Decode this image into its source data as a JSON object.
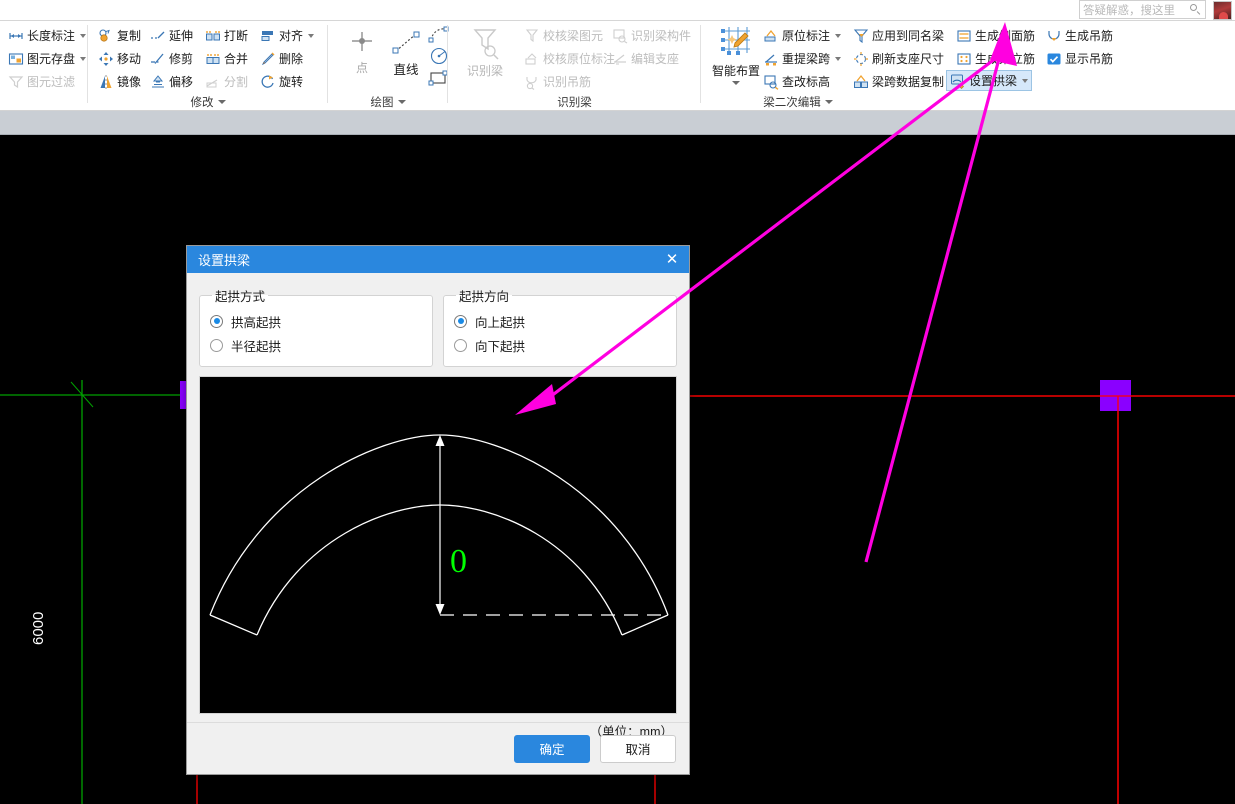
{
  "search": {
    "placeholder": "答疑解惑，搜这里",
    "icon": "search-icon",
    "avatar_name": "user-avatar"
  },
  "ribbon": {
    "groups": [
      {
        "name": "annotation",
        "label": "",
        "items": [
          {
            "label": "长度标注",
            "icon": "length-dimension-icon",
            "caret": true,
            "disabled": false
          },
          {
            "label": "图元存盘",
            "icon": "save-element-icon",
            "caret": true,
            "disabled": false
          },
          {
            "label": "图元过滤",
            "icon": "filter-element-icon",
            "caret": false,
            "disabled": true
          }
        ]
      },
      {
        "name": "modify",
        "label": "修改",
        "caret": true,
        "items": [
          {
            "label": "复制",
            "icon": "copy-icon",
            "disabled": false
          },
          {
            "label": "延伸",
            "icon": "extend-icon",
            "disabled": false
          },
          {
            "label": "打断",
            "icon": "break-icon",
            "disabled": false
          },
          {
            "label": "对齐",
            "icon": "align-icon",
            "caret": true,
            "disabled": false
          },
          {
            "label": "移动",
            "icon": "move-icon",
            "disabled": false
          },
          {
            "label": "修剪",
            "icon": "trim-icon",
            "disabled": false
          },
          {
            "label": "合并",
            "icon": "merge-icon",
            "disabled": false
          },
          {
            "label": "删除",
            "icon": "delete-icon",
            "disabled": false
          },
          {
            "label": "镜像",
            "icon": "mirror-icon",
            "disabled": false
          },
          {
            "label": "偏移",
            "icon": "offset-icon",
            "disabled": false
          },
          {
            "label": "分割",
            "icon": "split-icon",
            "disabled": true
          },
          {
            "label": "旋转",
            "icon": "rotate-icon",
            "disabled": false
          }
        ]
      },
      {
        "name": "draw",
        "label": "绘图",
        "caret": true,
        "items": [
          {
            "label": "点",
            "icon": "point-icon",
            "disabled": true
          },
          {
            "label": "直线",
            "icon": "line-icon",
            "disabled": false
          },
          {
            "label": "",
            "icon": "arc-icon",
            "disabled": false
          },
          {
            "label": "",
            "icon": "circle-icon",
            "disabled": false
          },
          {
            "label": "",
            "icon": "rectangle-icon",
            "disabled": false
          }
        ]
      },
      {
        "name": "identify-beam",
        "label": "识别梁",
        "caret": false,
        "big": {
          "label": "识别梁",
          "icon": "identify-beam-icon",
          "disabled": true
        },
        "items": [
          {
            "label": "校核梁图元",
            "icon": "check-beam-element-icon",
            "disabled": true
          },
          {
            "label": "识别梁构件",
            "icon": "identify-beam-member-icon",
            "disabled": true
          },
          {
            "label": "校核原位标注",
            "icon": "check-inplace-note-icon",
            "disabled": true
          },
          {
            "label": "编辑支座",
            "icon": "edit-support-icon",
            "disabled": true
          },
          {
            "label": "识别吊筋",
            "icon": "identify-hanger-icon",
            "disabled": true
          }
        ]
      },
      {
        "name": "beam-secondary-edit",
        "label": "梁二次编辑",
        "caret": true,
        "big": {
          "label": "智能布置",
          "icon": "smart-layout-icon",
          "caret": true,
          "disabled": false
        },
        "items": [
          {
            "label": "原位标注",
            "icon": "inplace-note-icon",
            "caret": true,
            "disabled": false
          },
          {
            "label": "应用到同名梁",
            "icon": "apply-same-name-icon",
            "caret": false,
            "disabled": false
          },
          {
            "label": "生成侧面筋",
            "icon": "gen-side-rebar-icon",
            "caret": false,
            "disabled": false
          },
          {
            "label": "生成吊筋",
            "icon": "gen-hanger-icon",
            "caret": false,
            "disabled": false
          },
          {
            "label": "重提梁跨",
            "icon": "reextract-span-icon",
            "caret": true,
            "disabled": false
          },
          {
            "label": "刷新支座尺寸",
            "icon": "refresh-support-icon",
            "caret": false,
            "disabled": false
          },
          {
            "label": "生成架立筋",
            "icon": "gen-erection-rebar-icon",
            "caret": false,
            "disabled": false
          },
          {
            "label": "显示吊筋",
            "icon": "show-hanger-icon",
            "caret": false,
            "disabled": false,
            "checked": true
          },
          {
            "label": "查改标高",
            "icon": "check-elevation-icon",
            "caret": false,
            "disabled": false
          },
          {
            "label": "梁跨数据复制",
            "icon": "copy-span-data-icon",
            "caret": false,
            "disabled": false
          },
          {
            "label": "设置拱梁",
            "icon": "set-arch-beam-icon",
            "caret": true,
            "disabled": false,
            "selected": true
          }
        ]
      }
    ]
  },
  "canvas": {
    "dimension_label": "6000",
    "crosshair_color": "#00a000",
    "grid_line_color": "#ff0000",
    "marker_color": "#8a00ff"
  },
  "dialog": {
    "title": "设置拱梁",
    "close_label": "✕",
    "groups": [
      {
        "legend": "起拱方式",
        "options": [
          {
            "label": "拱高起拱",
            "selected": true
          },
          {
            "label": "半径起拱",
            "selected": false
          }
        ]
      },
      {
        "legend": "起拱方向",
        "options": [
          {
            "label": "向上起拱",
            "selected": true
          },
          {
            "label": "向下起拱",
            "selected": false
          }
        ]
      }
    ],
    "preview": {
      "value_label": "0",
      "value_color": "#00ff00",
      "line_color": "#ffffff",
      "background": "#000000"
    },
    "unit_note": "（单位：mm）",
    "ok_label": "确定",
    "cancel_label": "取消"
  },
  "annotations": {
    "arrow_color": "#ff00e0",
    "arrow1_name": "callout-arrow-to-preview",
    "arrow2_name": "callout-arrow-to-set-arch-beam"
  }
}
